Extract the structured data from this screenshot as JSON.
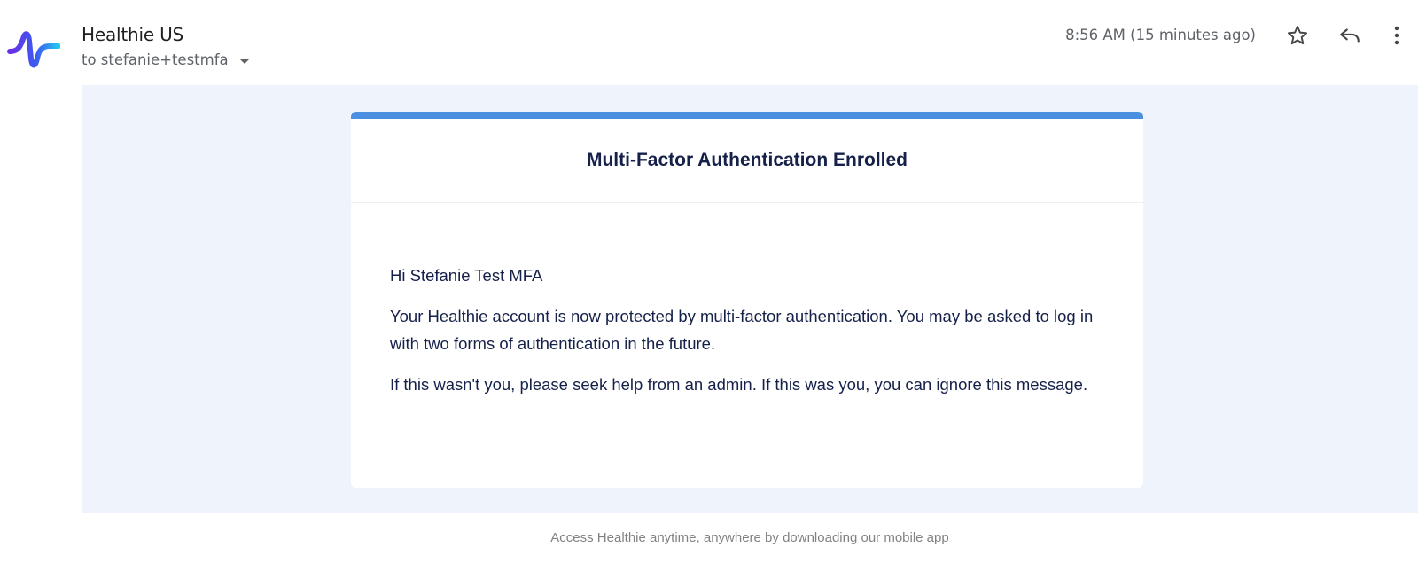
{
  "sender": {
    "name": "Healthie US",
    "recipient": "to stefanie+testmfa",
    "avatar_icon": "healthie-logo-icon"
  },
  "header": {
    "timestamp": "8:56 AM (15 minutes ago)",
    "actions": [
      {
        "name": "star",
        "icon": "star-icon"
      },
      {
        "name": "reply",
        "icon": "reply-icon"
      },
      {
        "name": "more",
        "icon": "more-vert-icon"
      }
    ]
  },
  "email": {
    "title": "Multi-Factor Authentication Enrolled",
    "greeting": "Hi Stefanie Test MFA",
    "paragraph1": "Your Healthie account is now protected by multi-factor authentication. You may be asked to log in with two forms of authentication in the future.",
    "paragraph2": "If this wasn't you, please seek help from an admin. If this was you, you can ignore this message.",
    "footer": "Access Healthie anytime, anywhere by downloading our mobile app"
  },
  "colors": {
    "accent_bar": "#4a8fe0",
    "email_background": "#eef3fc",
    "text_dark": "#16214a",
    "footer_text": "#808284"
  }
}
